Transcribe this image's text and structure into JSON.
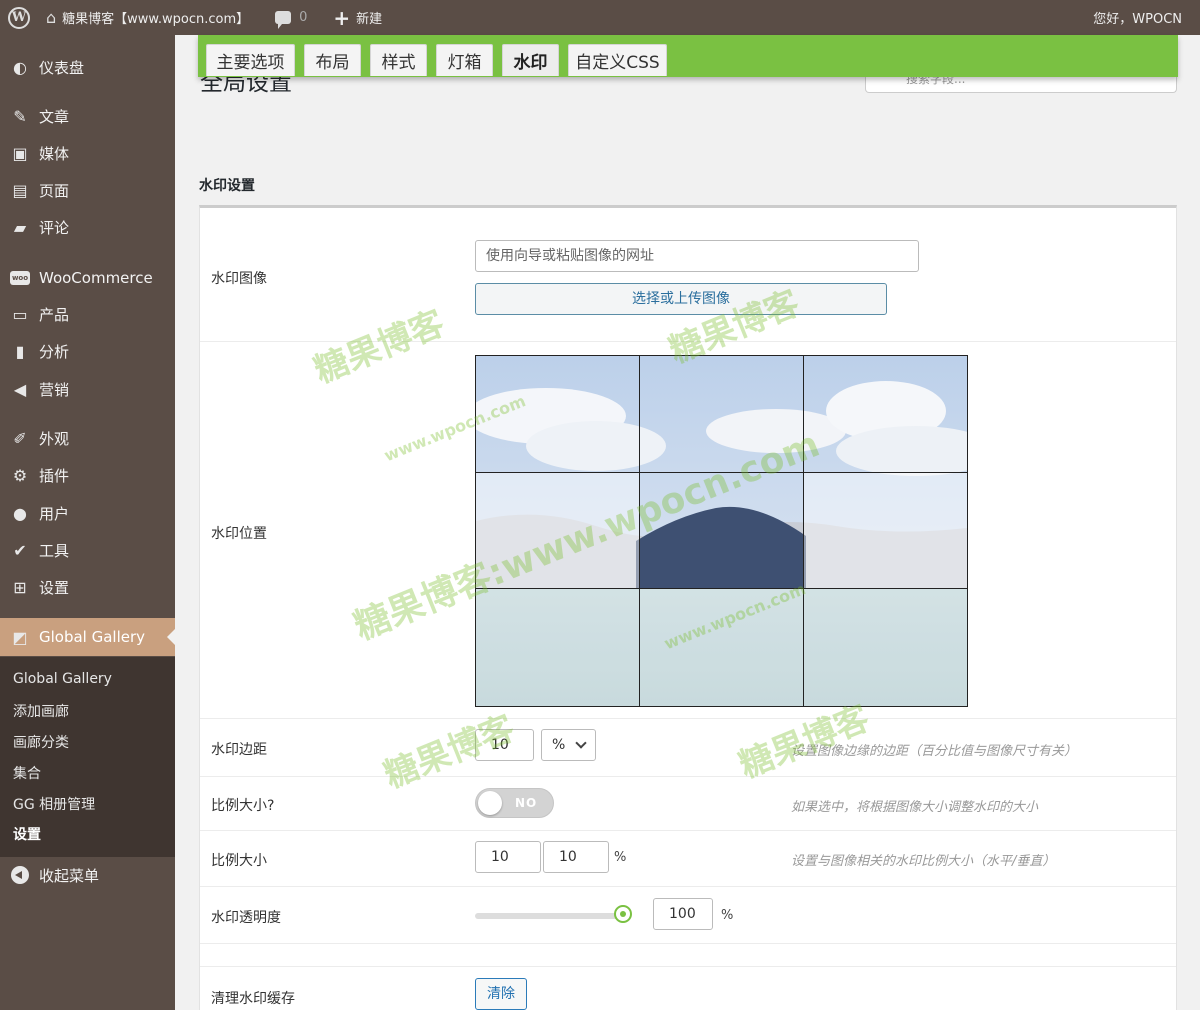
{
  "adminbar": {
    "site_name": "糖果博客【www.wpocn.com】",
    "comments_count": "0",
    "new_label": "新建",
    "greeting": "您好，WPOCN"
  },
  "sidebar": {
    "items": [
      {
        "label": "仪表盘",
        "icon": "dashboard-icon"
      },
      {
        "label": "文章",
        "icon": "pin-icon"
      },
      {
        "label": "媒体",
        "icon": "media-icon"
      },
      {
        "label": "页面",
        "icon": "page-icon"
      },
      {
        "label": "评论",
        "icon": "comment-icon"
      },
      {
        "label": "WooCommerce",
        "icon": "woocommerce-icon"
      },
      {
        "label": "产品",
        "icon": "archive-icon"
      },
      {
        "label": "分析",
        "icon": "chart-icon"
      },
      {
        "label": "营销",
        "icon": "megaphone-icon"
      },
      {
        "label": "外观",
        "icon": "brush-icon"
      },
      {
        "label": "插件",
        "icon": "plugin-icon"
      },
      {
        "label": "用户",
        "icon": "user-icon"
      },
      {
        "label": "工具",
        "icon": "wrench-icon"
      },
      {
        "label": "设置",
        "icon": "settings-icon"
      },
      {
        "label": "Global Gallery",
        "icon": "gallery-icon"
      }
    ],
    "submenu": [
      {
        "label": "Global Gallery"
      },
      {
        "label": "添加画廊"
      },
      {
        "label": "画廊分类"
      },
      {
        "label": "集合"
      },
      {
        "label": "GG 相册管理"
      },
      {
        "label": "设置"
      }
    ],
    "collapse_label": "收起菜单"
  },
  "header": {
    "page_title": "全局设置",
    "search_placeholder": "搜索字段..."
  },
  "tabs": [
    "主要选项",
    "布局",
    "样式",
    "灯箱",
    "水印",
    "自定义CSS"
  ],
  "active_tab": "水印",
  "section": {
    "title": "水印设置",
    "image_label": "水印图像",
    "url_placeholder": "使用向导或粘贴图像的网址",
    "upload_button": "选择或上传图像",
    "position_label": "水印位置",
    "margin_label": "水印边距",
    "margin_value": "10",
    "margin_unit": "%",
    "margin_hint": "设置图像边缘的边距（百分比值与图像尺寸有关）",
    "proportional_label": "比例大小?",
    "proportional_toggle": "NO",
    "proportional_hint": "如果选中，将根据图像大小调整水印的大小",
    "scale_label": "比例大小",
    "scale_h": "10",
    "scale_v": "10",
    "scale_unit": "%",
    "scale_hint": "设置与图像相关的水印比例大小（水平/垂直）",
    "opacity_label": "水印透明度",
    "opacity_value": "100",
    "opacity_unit": "%",
    "opacity_level": 1.0,
    "cache_label": "清理水印缓存",
    "clear_button": "清除"
  },
  "watermarks": [
    "糖果博客",
    "www.wpocn.com",
    "糖果博客:www.wpocn.com"
  ],
  "colors": {
    "admin_bar": "#5a4d46",
    "accent_green": "#7ac142",
    "active_menu": "#c9a07f"
  }
}
